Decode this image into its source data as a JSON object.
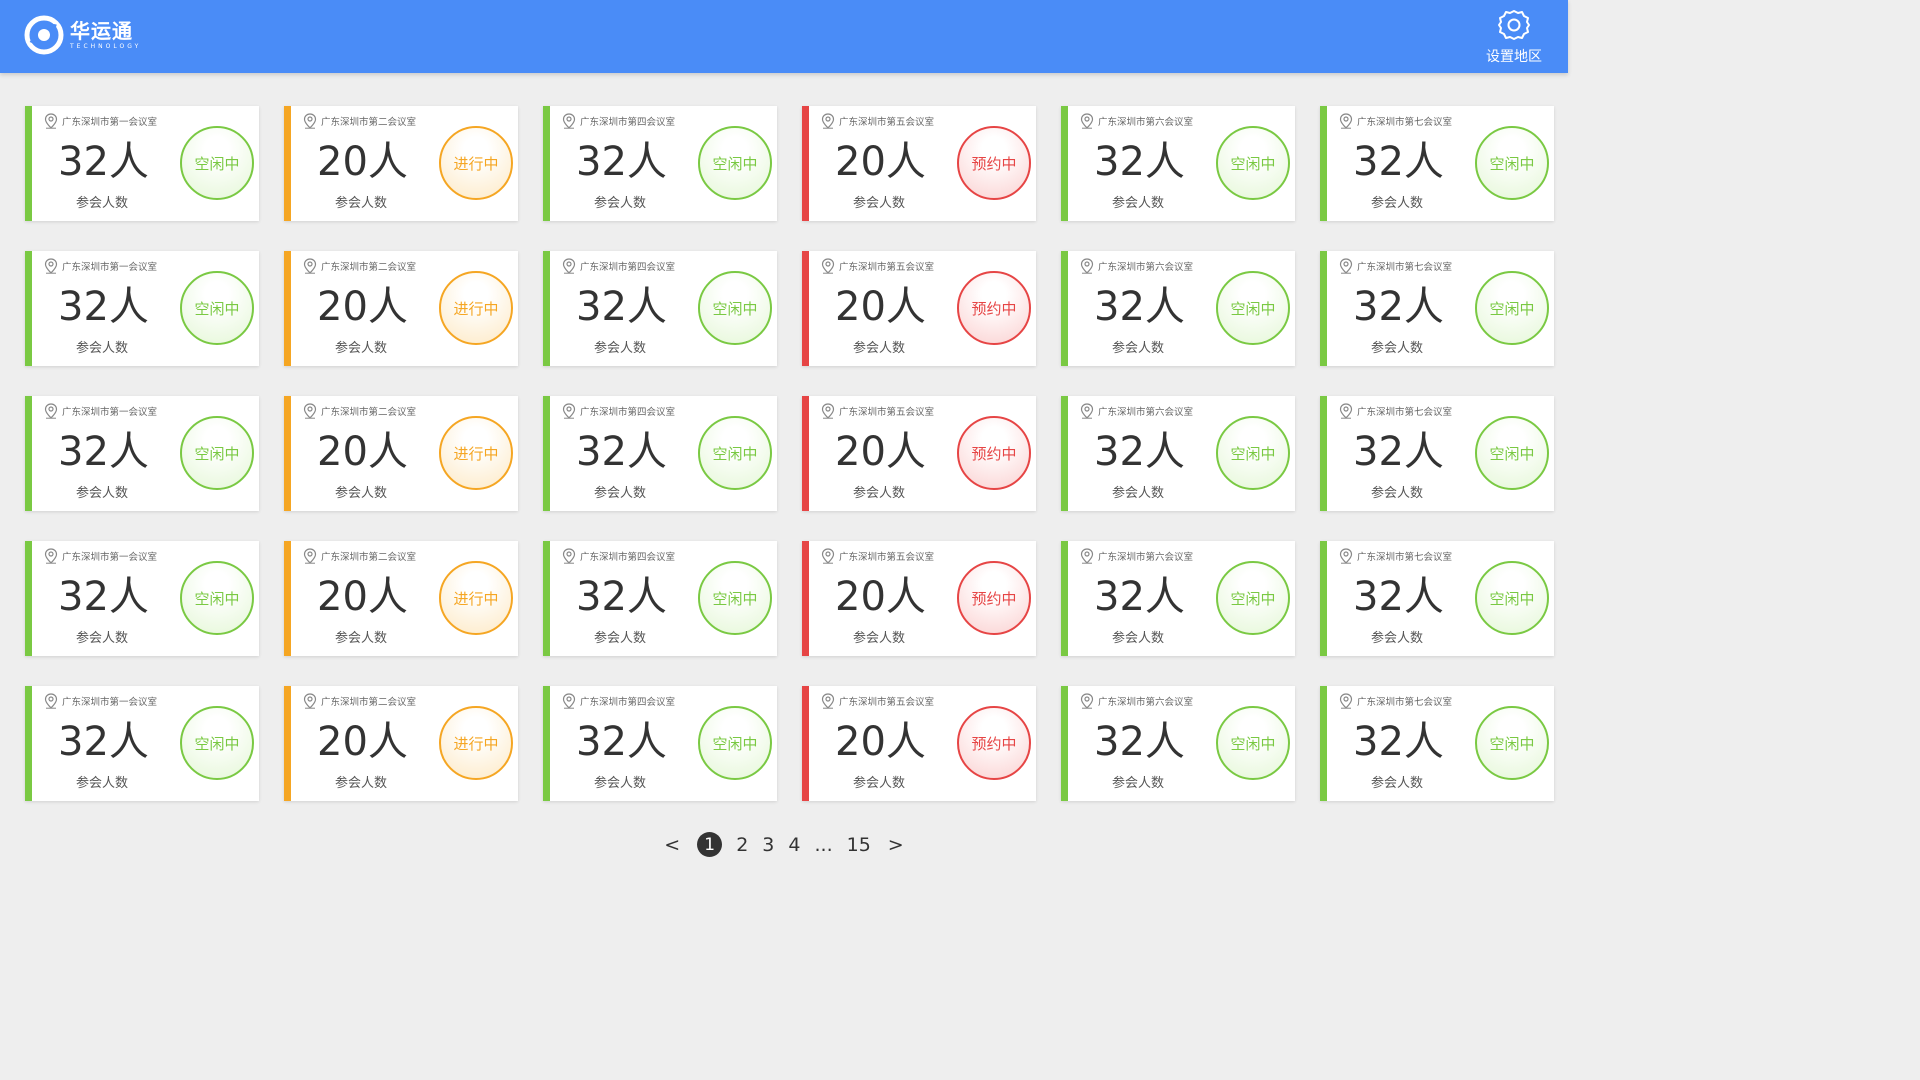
{
  "header": {
    "logo_title": "华运通",
    "logo_subtitle": "TECHNOLOGY",
    "settings_label": "设置地区",
    "background_color": "#4a8cf7"
  },
  "colors": {
    "green": "#7ac943",
    "orange": "#f5a623",
    "red": "#e64545"
  },
  "cards": [
    {
      "location": "广东深圳市第一会议室",
      "count": "32人",
      "count_label": "参会人数",
      "status": "空闲中",
      "color": "green"
    },
    {
      "location": "广东深圳市第二会议室",
      "count": "20人",
      "count_label": "参会人数",
      "status": "进行中",
      "color": "orange"
    },
    {
      "location": "广东深圳市第四会议室",
      "count": "32人",
      "count_label": "参会人数",
      "status": "空闲中",
      "color": "green"
    },
    {
      "location": "广东深圳市第五会议室",
      "count": "20人",
      "count_label": "参会人数",
      "status": "预约中",
      "color": "red"
    },
    {
      "location": "广东深圳市第六会议室",
      "count": "32人",
      "count_label": "参会人数",
      "status": "空闲中",
      "color": "green"
    },
    {
      "location": "广东深圳市第七会议室",
      "count": "32人",
      "count_label": "参会人数",
      "status": "空闲中",
      "color": "green"
    },
    {
      "location": "广东深圳市第一会议室",
      "count": "32人",
      "count_label": "参会人数",
      "status": "空闲中",
      "color": "green"
    },
    {
      "location": "广东深圳市第二会议室",
      "count": "20人",
      "count_label": "参会人数",
      "status": "进行中",
      "color": "orange"
    },
    {
      "location": "广东深圳市第四会议室",
      "count": "32人",
      "count_label": "参会人数",
      "status": "空闲中",
      "color": "green"
    },
    {
      "location": "广东深圳市第五会议室",
      "count": "20人",
      "count_label": "参会人数",
      "status": "预约中",
      "color": "red"
    },
    {
      "location": "广东深圳市第六会议室",
      "count": "32人",
      "count_label": "参会人数",
      "status": "空闲中",
      "color": "green"
    },
    {
      "location": "广东深圳市第七会议室",
      "count": "32人",
      "count_label": "参会人数",
      "status": "空闲中",
      "color": "green"
    },
    {
      "location": "广东深圳市第一会议室",
      "count": "32人",
      "count_label": "参会人数",
      "status": "空闲中",
      "color": "green"
    },
    {
      "location": "广东深圳市第二会议室",
      "count": "20人",
      "count_label": "参会人数",
      "status": "进行中",
      "color": "orange"
    },
    {
      "location": "广东深圳市第四会议室",
      "count": "32人",
      "count_label": "参会人数",
      "status": "空闲中",
      "color": "green"
    },
    {
      "location": "广东深圳市第五会议室",
      "count": "20人",
      "count_label": "参会人数",
      "status": "预约中",
      "color": "red"
    },
    {
      "location": "广东深圳市第六会议室",
      "count": "32人",
      "count_label": "参会人数",
      "status": "空闲中",
      "color": "green"
    },
    {
      "location": "广东深圳市第七会议室",
      "count": "32人",
      "count_label": "参会人数",
      "status": "空闲中",
      "color": "green"
    },
    {
      "location": "广东深圳市第一会议室",
      "count": "32人",
      "count_label": "参会人数",
      "status": "空闲中",
      "color": "green"
    },
    {
      "location": "广东深圳市第二会议室",
      "count": "20人",
      "count_label": "参会人数",
      "status": "进行中",
      "color": "orange"
    },
    {
      "location": "广东深圳市第四会议室",
      "count": "32人",
      "count_label": "参会人数",
      "status": "空闲中",
      "color": "green"
    },
    {
      "location": "广东深圳市第五会议室",
      "count": "20人",
      "count_label": "参会人数",
      "status": "预约中",
      "color": "red"
    },
    {
      "location": "广东深圳市第六会议室",
      "count": "32人",
      "count_label": "参会人数",
      "status": "空闲中",
      "color": "green"
    },
    {
      "location": "广东深圳市第七会议室",
      "count": "32人",
      "count_label": "参会人数",
      "status": "空闲中",
      "color": "green"
    },
    {
      "location": "广东深圳市第一会议室",
      "count": "32人",
      "count_label": "参会人数",
      "status": "空闲中",
      "color": "green"
    },
    {
      "location": "广东深圳市第二会议室",
      "count": "20人",
      "count_label": "参会人数",
      "status": "进行中",
      "color": "orange"
    },
    {
      "location": "广东深圳市第四会议室",
      "count": "32人",
      "count_label": "参会人数",
      "status": "空闲中",
      "color": "green"
    },
    {
      "location": "广东深圳市第五会议室",
      "count": "20人",
      "count_label": "参会人数",
      "status": "预约中",
      "color": "red"
    },
    {
      "location": "广东深圳市第六会议室",
      "count": "32人",
      "count_label": "参会人数",
      "status": "空闲中",
      "color": "green"
    },
    {
      "location": "广东深圳市第七会议室",
      "count": "32人",
      "count_label": "参会人数",
      "status": "空闲中",
      "color": "green"
    }
  ],
  "pagination": {
    "prev": "<",
    "pages": [
      "1",
      "2",
      "3",
      "4",
      "...",
      "15"
    ],
    "current": "1",
    "next": ">"
  }
}
